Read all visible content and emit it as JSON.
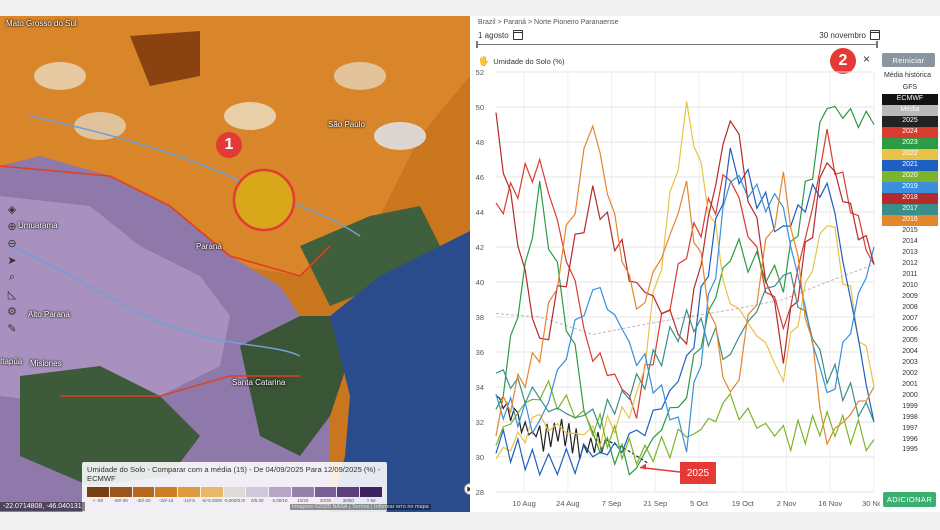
{
  "map": {
    "places": [
      {
        "name": "Mato Grosso do Sul"
      },
      {
        "name": "São Paulo"
      },
      {
        "name": "Paraná"
      },
      {
        "name": "Umuarama"
      },
      {
        "name": "Alto Paraná"
      },
      {
        "name": "Misiones"
      },
      {
        "name": "Santa Catarina"
      },
      {
        "name": "Itapúa"
      }
    ],
    "badges": [
      "1",
      "2"
    ],
    "legend": {
      "title": "Umidade do Solo - Comparar com a média (15) - De 04/09/2025 Para 12/09/2025 (%) - ECMWF",
      "colors": [
        "#7a3f10",
        "#9c5518",
        "#b8681c",
        "#d07e22",
        "#e09a3e",
        "#e8b868",
        "#dddbd6",
        "#cfc8d8",
        "#b5a6c8",
        "#9580b0",
        "#7a5e98",
        "#5c3f7c",
        "#3d2460"
      ],
      "labels": [
        "< -50",
        "-50/-30",
        "-30/-20",
        "-20/-10",
        "-10/-5",
        "-5/-5.0000",
        "-5.000/0.00",
        "0/5.00",
        "5.00/10",
        "10/20",
        "20/30",
        "30/50",
        "> 50"
      ]
    },
    "coords": "-22.0714808, -46.040131",
    "attribution": "Imagens ©2025 NASA | Termos | Informar erro no mapa",
    "tool_icons": [
      "layers-icon",
      "zoom-in-icon",
      "zoom-out-icon",
      "locate-icon",
      "search-icon",
      "measure-icon",
      "settings-icon",
      "draw-icon"
    ]
  },
  "panel": {
    "breadcrumb": "Brazil > Paraná > Norte Pioneiro Paranaense",
    "date_from": "1 agosto",
    "date_to": "30 novembro",
    "chart_title": "Umidade do Solo (%)",
    "reset_label": "Reiniciar",
    "close_label": "×",
    "historical_label": "Média histórica",
    "add_label": "ADICIONAR",
    "callout_2025": "2025",
    "series": [
      {
        "label": "GFS",
        "color": "",
        "active": false
      },
      {
        "label": "ECMWF",
        "color": "#111111",
        "active": true
      },
      {
        "label": "Média",
        "color": "#b9b9b9",
        "active": true
      },
      {
        "label": "2025",
        "color": "#222222",
        "active": true
      },
      {
        "label": "2024",
        "color": "#d93c2f",
        "active": true
      },
      {
        "label": "2023",
        "color": "#2e9a44",
        "active": true
      },
      {
        "label": "2022",
        "color": "#e9c247",
        "active": true
      },
      {
        "label": "2021",
        "color": "#1e5fbf",
        "active": true
      },
      {
        "label": "2020",
        "color": "#7ab52a",
        "active": true
      },
      {
        "label": "2019",
        "color": "#3b8fdc",
        "active": true
      },
      {
        "label": "2018",
        "color": "#b52a2a",
        "active": true
      },
      {
        "label": "2017",
        "color": "#3a8f8a",
        "active": true
      },
      {
        "label": "2016",
        "color": "#e4862c",
        "active": true
      },
      {
        "label": "2015",
        "color": "",
        "active": false
      },
      {
        "label": "2014",
        "color": "",
        "active": false
      },
      {
        "label": "2013",
        "color": "",
        "active": false
      },
      {
        "label": "2012",
        "color": "",
        "active": false
      },
      {
        "label": "2011",
        "color": "",
        "active": false
      },
      {
        "label": "2010",
        "color": "",
        "active": false
      },
      {
        "label": "2009",
        "color": "",
        "active": false
      },
      {
        "label": "2008",
        "color": "",
        "active": false
      },
      {
        "label": "2007",
        "color": "",
        "active": false
      },
      {
        "label": "2006",
        "color": "",
        "active": false
      },
      {
        "label": "2005",
        "color": "",
        "active": false
      },
      {
        "label": "2004",
        "color": "",
        "active": false
      },
      {
        "label": "2003",
        "color": "",
        "active": false
      },
      {
        "label": "2002",
        "color": "",
        "active": false
      },
      {
        "label": "2001",
        "color": "",
        "active": false
      },
      {
        "label": "2000",
        "color": "",
        "active": false
      },
      {
        "label": "1999",
        "color": "",
        "active": false
      },
      {
        "label": "1998",
        "color": "",
        "active": false
      },
      {
        "label": "1997",
        "color": "",
        "active": false
      },
      {
        "label": "1996",
        "color": "",
        "active": false
      },
      {
        "label": "1995",
        "color": "",
        "active": false
      }
    ]
  },
  "chart_data": {
    "type": "line",
    "title": "Umidade do Solo (%)",
    "x_tick_labels": [
      "10 Aug",
      "24 Aug",
      "7 Sep",
      "21 Sep",
      "5 Oct",
      "19 Oct",
      "2 Nov",
      "16 Nov",
      "30 Nov"
    ],
    "y_tick_labels": [
      28,
      30,
      32,
      34,
      36,
      38,
      40,
      42,
      44,
      46,
      48,
      50,
      52
    ],
    "ylim": [
      28,
      52
    ],
    "xlim": [
      "2025-08-01",
      "2025-11-30"
    ],
    "grid": true,
    "series": [
      {
        "name": "2025",
        "style": "solid",
        "x": [
          "2025-08-01",
          "2025-08-08",
          "2025-08-15",
          "2025-08-22",
          "2025-08-29",
          "2025-09-05"
        ],
        "values": [
          33.5,
          32.0,
          31.0,
          31.5,
          30.5,
          31.0
        ]
      },
      {
        "name": "2025 (previsão)",
        "style": "dashed",
        "x": [
          "2025-09-05",
          "2025-09-12",
          "2025-09-19"
        ],
        "values": [
          31.0,
          30.4,
          29.6
        ]
      },
      {
        "name": "Média",
        "style": "dashed",
        "x": [
          "2025-08-01",
          "2025-08-15",
          "2025-09-01",
          "2025-09-15",
          "2025-10-01",
          "2025-10-15",
          "2025-11-01",
          "2025-11-15",
          "2025-11-30"
        ],
        "values": [
          38.2,
          38.0,
          37.0,
          37.5,
          38.0,
          38.4,
          39.0,
          40.0,
          41.0
        ]
      },
      {
        "name": "2024",
        "style": "solid",
        "x": [
          "2025-08-01",
          "2025-08-15",
          "2025-09-01",
          "2025-09-15",
          "2025-10-01",
          "2025-10-15",
          "2025-11-01",
          "2025-11-15",
          "2025-11-30"
        ],
        "values": [
          44,
          47,
          36,
          33,
          42,
          46,
          37,
          48,
          41
        ]
      },
      {
        "name": "2023",
        "style": "solid",
        "x": [
          "2025-08-01",
          "2025-08-15",
          "2025-09-01",
          "2025-09-15",
          "2025-10-01",
          "2025-10-15",
          "2025-11-01",
          "2025-11-15",
          "2025-11-30"
        ],
        "values": [
          32,
          45,
          31,
          29.5,
          34,
          42,
          40,
          50,
          49
        ]
      },
      {
        "name": "2022",
        "style": "solid",
        "x": [
          "2025-08-01",
          "2025-08-15",
          "2025-09-01",
          "2025-09-15",
          "2025-10-01",
          "2025-10-15",
          "2025-11-01",
          "2025-11-15",
          "2025-11-30"
        ],
        "values": [
          30,
          32,
          31,
          33,
          50,
          39,
          35,
          44,
          34
        ]
      },
      {
        "name": "2021",
        "style": "solid",
        "x": [
          "2025-08-01",
          "2025-08-15",
          "2025-09-01",
          "2025-09-15",
          "2025-10-01",
          "2025-10-15",
          "2025-11-01",
          "2025-11-15",
          "2025-11-30"
        ],
        "values": [
          31,
          29.5,
          30,
          31,
          35,
          47,
          43,
          46,
          32
        ]
      },
      {
        "name": "2020",
        "style": "solid",
        "x": [
          "2025-08-01",
          "2025-08-15",
          "2025-09-01",
          "2025-09-15",
          "2025-10-01",
          "2025-10-15",
          "2025-11-01",
          "2025-11-15",
          "2025-11-30"
        ],
        "values": [
          31,
          34,
          32,
          30,
          31,
          33,
          31,
          32,
          31
        ]
      },
      {
        "name": "2019",
        "style": "solid",
        "x": [
          "2025-08-01",
          "2025-08-15",
          "2025-09-01",
          "2025-09-15",
          "2025-10-01",
          "2025-10-15",
          "2025-11-01",
          "2025-11-15",
          "2025-11-30"
        ],
        "values": [
          33,
          32,
          40,
          36,
          31,
          46,
          44,
          33,
          42
        ]
      },
      {
        "name": "2018",
        "style": "solid",
        "x": [
          "2025-08-01",
          "2025-08-15",
          "2025-09-01",
          "2025-09-15",
          "2025-10-01",
          "2025-10-15",
          "2025-11-01",
          "2025-11-15",
          "2025-11-30"
        ],
        "values": [
          49,
          36,
          45,
          40,
          37,
          50,
          36,
          47,
          41
        ]
      },
      {
        "name": "2017",
        "style": "solid",
        "x": [
          "2025-08-01",
          "2025-08-15",
          "2025-09-01",
          "2025-09-15",
          "2025-10-01",
          "2025-10-15",
          "2025-11-01",
          "2025-11-15",
          "2025-11-30"
        ],
        "values": [
          35,
          33,
          32,
          34,
          38,
          36,
          41,
          35,
          32
        ]
      },
      {
        "name": "2016",
        "style": "solid",
        "x": [
          "2025-08-01",
          "2025-08-15",
          "2025-09-01",
          "2025-09-15",
          "2025-10-01",
          "2025-10-15",
          "2025-11-01",
          "2025-11-15",
          "2025-11-30"
        ],
        "values": [
          32,
          36,
          49,
          38,
          45,
          33,
          46,
          31,
          34
        ]
      }
    ]
  }
}
